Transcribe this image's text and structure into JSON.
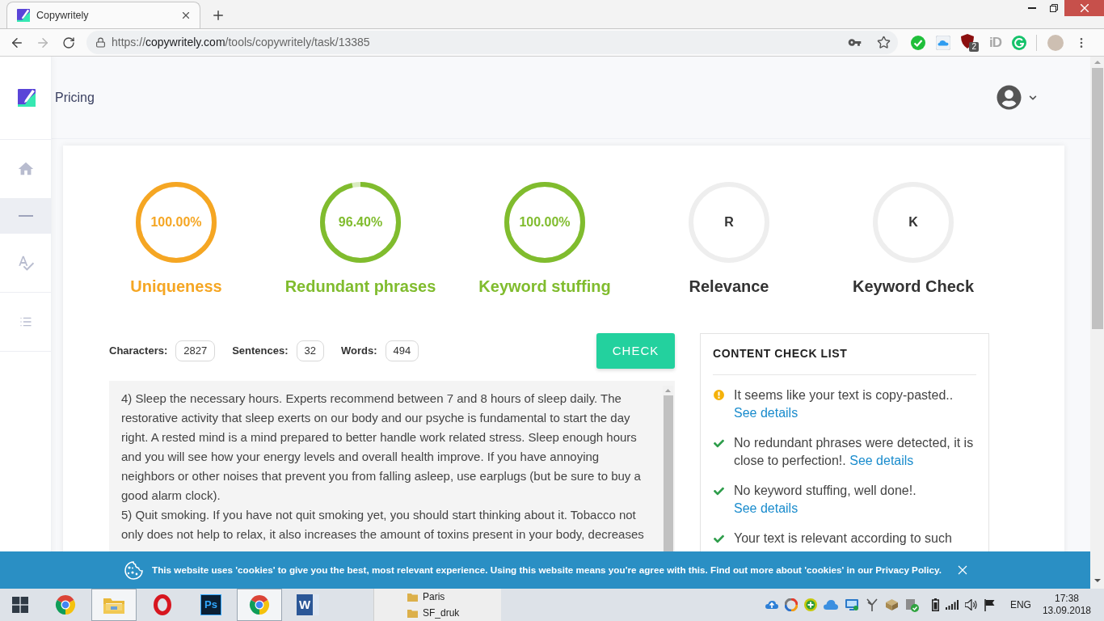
{
  "browser": {
    "tab": {
      "title": "Copywritely",
      "selected": true
    },
    "url": {
      "scheme": "https://",
      "domain": "copywritely.com",
      "path": "/tools/copywritely/task/13385"
    },
    "extensions": [
      {
        "kind": "check"
      },
      {
        "kind": "cloud"
      },
      {
        "kind": "shield",
        "badge": "2"
      },
      {
        "kind": "letters",
        "text": "iD"
      },
      {
        "kind": "circle-arrow"
      }
    ]
  },
  "header": {
    "nav_link": "Pricing"
  },
  "sidebar": {
    "items": [
      {
        "kind": "home",
        "selected": false
      },
      {
        "kind": "minus",
        "selected": true
      },
      {
        "kind": "spellcheck",
        "selected": false
      },
      {
        "kind": "list",
        "selected": false
      }
    ]
  },
  "gauges": [
    {
      "kind": "score",
      "value": "100.00%",
      "label": "Uniqueness",
      "level": 1,
      "color": "#f5a623"
    },
    {
      "kind": "score",
      "value": "96.40%",
      "label": "Redundant phrases",
      "level": 0.964,
      "color": "#80bc2e"
    },
    {
      "kind": "score",
      "value": "100.00%",
      "label": "Keyword stuffing",
      "level": 1,
      "color": "#80bc2e"
    },
    {
      "kind": "pending",
      "value": "R",
      "label": "Relevance"
    },
    {
      "kind": "pending",
      "value": "K",
      "label": "Keyword Check"
    }
  ],
  "stats": [
    {
      "label": "Characters:",
      "value": "2827"
    },
    {
      "label": "Sentences:",
      "value": "32"
    },
    {
      "label": "Words:",
      "value": "494"
    }
  ],
  "check_button": "CHECK",
  "editor": {
    "paragraphs": [
      "4) Sleep the necessary hours. Experts recommend between 7 and 8 hours of sleep daily. The restorative activity that sleep exerts on our body and our psyche is fundamental to start the day right. A rested mind is a mind prepared to better handle work related stress. Sleep enough hours and you will see how your energy levels and overall health improve. If you have annoying neighbors or other noises that prevent you from falling asleep, use earplugs (but be sure to buy a good alarm clock).",
      "5) Quit smoking. If you have not quit smoking yet, you should start thinking about it. Tobacco not only does not help to relax, it also increases the amount of toxins present in your body, decreases"
    ]
  },
  "checklist": {
    "title": "CONTENT CHECK LIST",
    "items": [
      {
        "kind": "warning",
        "text": "It seems like your text is copy-pasted..",
        "link": "See details"
      },
      {
        "kind": "ok",
        "text": "No redundant phrases were detected, it is close to perfection!.",
        "link": "See details"
      },
      {
        "kind": "ok",
        "text": "No keyword stuffing, well done!.",
        "link": "See details"
      },
      {
        "kind": "ok",
        "text": "Your text is relevant according to such"
      }
    ]
  },
  "cookie_banner": {
    "text": "This website uses 'cookies' to give you the best, most relevant experience. Using this website means you're agree with this. Find out more about 'cookies' in our Privacy Policy."
  },
  "taskbar": {
    "apps": [
      {
        "kind": "browser",
        "active": false
      },
      {
        "kind": "folder",
        "active": true
      },
      {
        "kind": "ring",
        "active": false
      },
      {
        "kind": "tile",
        "text": "Ps",
        "active": false
      },
      {
        "kind": "browser",
        "active": true
      },
      {
        "kind": "document",
        "text": "W",
        "active": false
      }
    ],
    "window_peek": [
      "Paris",
      "SF_druk"
    ],
    "tray": [
      {
        "kind": "upload"
      },
      {
        "kind": "swirl"
      },
      {
        "kind": "plus"
      },
      {
        "kind": "cloud"
      },
      {
        "kind": "monitor"
      },
      {
        "kind": "branch"
      },
      {
        "kind": "box"
      },
      {
        "kind": "check-badge"
      },
      {
        "kind": "battery"
      },
      {
        "kind": "signal"
      },
      {
        "kind": "speaker"
      },
      {
        "kind": "flag"
      }
    ],
    "language": "ENG",
    "time": "17:38",
    "date": "13.09.2018"
  }
}
